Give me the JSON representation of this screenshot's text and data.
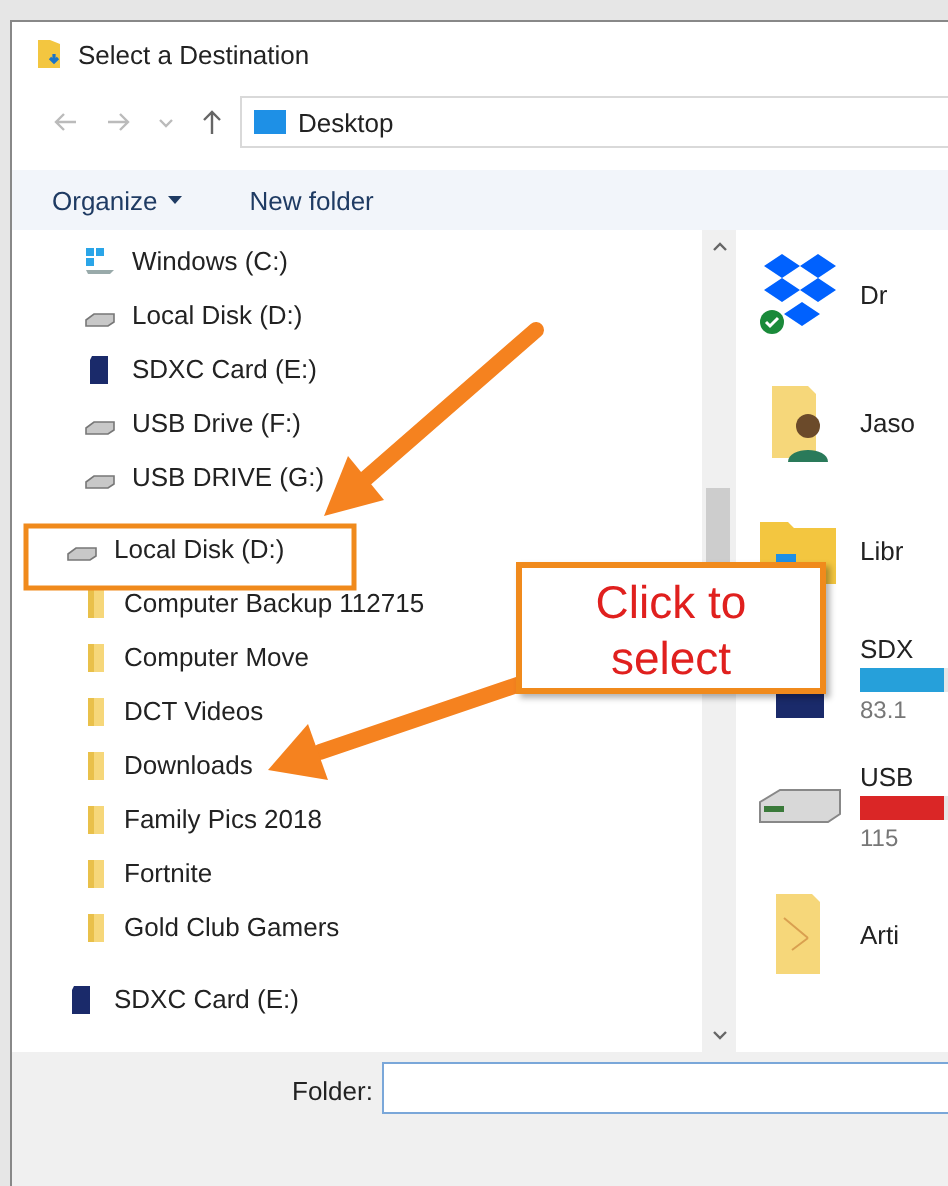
{
  "window": {
    "title": "Select a Destination"
  },
  "address_bar": {
    "location": "Desktop"
  },
  "toolbar": {
    "organize": "Organize",
    "new_folder": "New folder"
  },
  "drives": [
    {
      "label": "Windows (C:)",
      "kind": "windows-drive"
    },
    {
      "label": "Local Disk (D:)",
      "kind": "drive"
    },
    {
      "label": "SDXC Card (E:)",
      "kind": "sd-card"
    },
    {
      "label": "USB Drive (F:)",
      "kind": "drive"
    },
    {
      "label": "USB DRIVE (G:)",
      "kind": "drive"
    }
  ],
  "tree": [
    {
      "label": "Local Disk (D:)",
      "kind": "drive",
      "children": [
        {
          "label": "Computer Backup 112715",
          "kind": "folder"
        },
        {
          "label": "Computer Move",
          "kind": "folder"
        },
        {
          "label": "DCT Videos",
          "kind": "folder"
        },
        {
          "label": "Downloads",
          "kind": "folder"
        },
        {
          "label": "Family Pics 2018",
          "kind": "folder"
        },
        {
          "label": "Fortnite",
          "kind": "folder"
        },
        {
          "label": "Gold Club Gamers",
          "kind": "folder"
        }
      ]
    },
    {
      "label": "SDXC Card (E:)",
      "kind": "sd-card"
    }
  ],
  "content_items": [
    {
      "name": "Dr",
      "kind": "dropbox"
    },
    {
      "name": "Jaso",
      "kind": "user-folder"
    },
    {
      "name": "Libr",
      "kind": "libraries"
    },
    {
      "name": "SDX",
      "kind": "sd-card",
      "level": 0.95,
      "color": "#26a0da",
      "free": "83.1"
    },
    {
      "name": "USB",
      "kind": "drive",
      "level": 0.95,
      "color": "#da2626",
      "free": "115"
    },
    {
      "name": "Arti",
      "kind": "folder"
    }
  ],
  "footer": {
    "folder_label": "Folder:"
  },
  "annotation": {
    "callout": "Click to select"
  }
}
